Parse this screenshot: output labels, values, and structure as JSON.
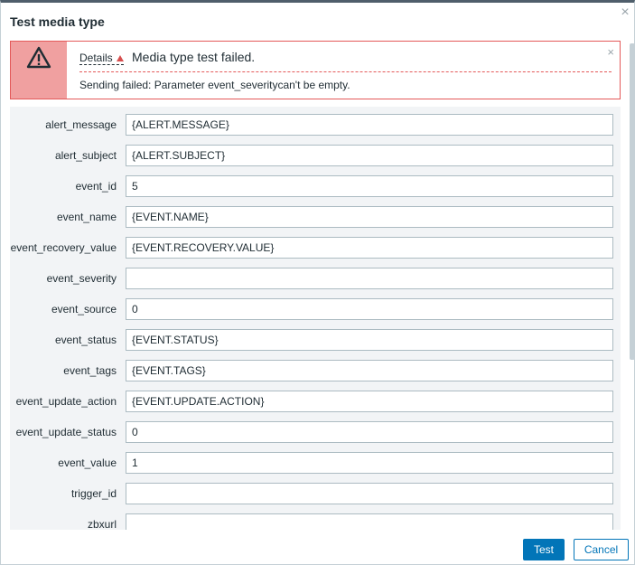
{
  "dialog": {
    "title": "Test media type",
    "close_glyph": "×"
  },
  "message": {
    "details_label": "Details",
    "title": "Media type test failed.",
    "close_glyph": "×",
    "text": "Sending failed: Parameter event_severitycan't be empty.",
    "icon": "warning-icon",
    "colors": {
      "border": "#e45959",
      "icon_background": "#f0a0a0"
    }
  },
  "params": [
    {
      "label": "alert_message",
      "value": "{ALERT.MESSAGE}"
    },
    {
      "label": "alert_subject",
      "value": "{ALERT.SUBJECT}"
    },
    {
      "label": "event_id",
      "value": "5"
    },
    {
      "label": "event_name",
      "value": "{EVENT.NAME}"
    },
    {
      "label": "event_recovery_value",
      "value": "{EVENT.RECOVERY.VALUE}"
    },
    {
      "label": "event_severity",
      "value": ""
    },
    {
      "label": "event_source",
      "value": "0"
    },
    {
      "label": "event_status",
      "value": "{EVENT.STATUS}"
    },
    {
      "label": "event_tags",
      "value": "{EVENT.TAGS}"
    },
    {
      "label": "event_update_action",
      "value": "{EVENT.UPDATE.ACTION}"
    },
    {
      "label": "event_update_status",
      "value": "0"
    },
    {
      "label": "event_value",
      "value": "1"
    },
    {
      "label": "trigger_id",
      "value": ""
    },
    {
      "label": "zbxurl",
      "value": ""
    }
  ],
  "buttons": {
    "test": "Test",
    "cancel": "Cancel"
  },
  "colors": {
    "primary": "#0275b8",
    "form_background": "#f2f4f6"
  }
}
